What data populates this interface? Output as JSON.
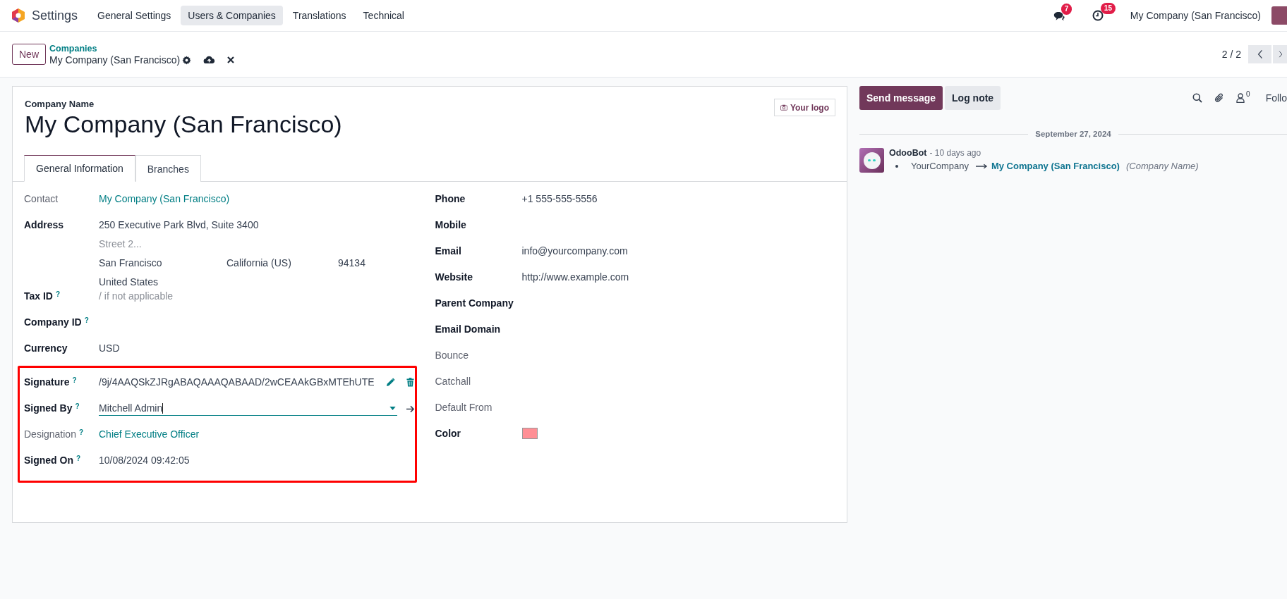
{
  "navbar": {
    "app_name": "Settings",
    "menu": [
      {
        "label": "General Settings",
        "selected": false
      },
      {
        "label": "Users & Companies",
        "selected": true
      },
      {
        "label": "Translations",
        "selected": false
      },
      {
        "label": "Technical",
        "selected": false
      }
    ],
    "messages_badge": "7",
    "activities_badge": "15",
    "company": "My Company (San Francisco)"
  },
  "control_panel": {
    "new_button": "New",
    "breadcrumb": "Companies",
    "record": "My Company (San Francisco)",
    "pager": "2 / 2"
  },
  "form": {
    "name_label": "Company Name",
    "name": "My Company (San Francisco)",
    "logo_button": "Your logo",
    "tabs": [
      {
        "label": "General Information",
        "selected": true
      },
      {
        "label": "Branches",
        "selected": false
      }
    ],
    "left_fields": [
      {
        "label": "Contact",
        "muted": true,
        "kind": "link",
        "value": "My Company (San Francisco)"
      },
      {
        "label": "Address",
        "muted": false,
        "kind": "address",
        "street": "250 Executive Park Blvd, Suite 3400",
        "street2_placeholder": "Street 2...",
        "city": "San Francisco",
        "state": "California (US)",
        "zip": "94134",
        "country": "United States"
      },
      {
        "label": "Tax ID",
        "muted": false,
        "help": "?",
        "kind": "placeholder",
        "placeholder": "/ if not applicable"
      },
      {
        "label": "Company ID",
        "muted": false,
        "help": "?",
        "kind": "text"
      },
      {
        "label": "Currency",
        "muted": false,
        "kind": "text",
        "value": "USD"
      }
    ],
    "highlighted_fields": [
      {
        "label": "Signature",
        "muted": false,
        "help": "?",
        "kind": "signature",
        "value": "/9j/4AAQSkZJRgABAQAAAQABAAD/2wCEAAkGBxMTEhUTE"
      },
      {
        "label": "Signed By",
        "muted": false,
        "help": "?",
        "kind": "many2one",
        "value": "Mitchell Admin"
      },
      {
        "label": "Designation",
        "muted": true,
        "help": "?",
        "kind": "link",
        "value": "Chief Executive Officer"
      },
      {
        "label": "Signed On",
        "muted": false,
        "help": "?",
        "kind": "text",
        "value": "10/08/2024 09:42:05"
      }
    ],
    "right_fields": [
      {
        "label": "Phone",
        "muted": false,
        "kind": "text",
        "value": "+1 555-555-5556"
      },
      {
        "label": "Mobile",
        "muted": false,
        "kind": "text"
      },
      {
        "label": "Email",
        "muted": false,
        "kind": "text",
        "value": "info@yourcompany.com"
      },
      {
        "label": "Website",
        "muted": false,
        "kind": "text",
        "value": "http://www.example.com"
      },
      {
        "label": "Parent Company",
        "muted": false,
        "kind": "text"
      },
      {
        "label": "Email Domain",
        "muted": false,
        "kind": "text"
      },
      {
        "label": "Bounce",
        "muted": true,
        "kind": "text"
      },
      {
        "label": "Catchall",
        "muted": true,
        "kind": "text"
      },
      {
        "label": "Default From",
        "muted": true,
        "kind": "text"
      },
      {
        "label": "Color",
        "muted": false,
        "kind": "color",
        "color": "#ff8f95"
      }
    ]
  },
  "chatter": {
    "send_button": "Send message",
    "log_button": "Log note",
    "followers_count": "0",
    "follow": "Follo",
    "date": "September 27, 2024",
    "message": {
      "author": "OdooBot",
      "time": "- 10 days ago",
      "old_value": "YourCompany",
      "new_value": "My Company (San Francisco)",
      "field": "(Company Name)"
    }
  }
}
